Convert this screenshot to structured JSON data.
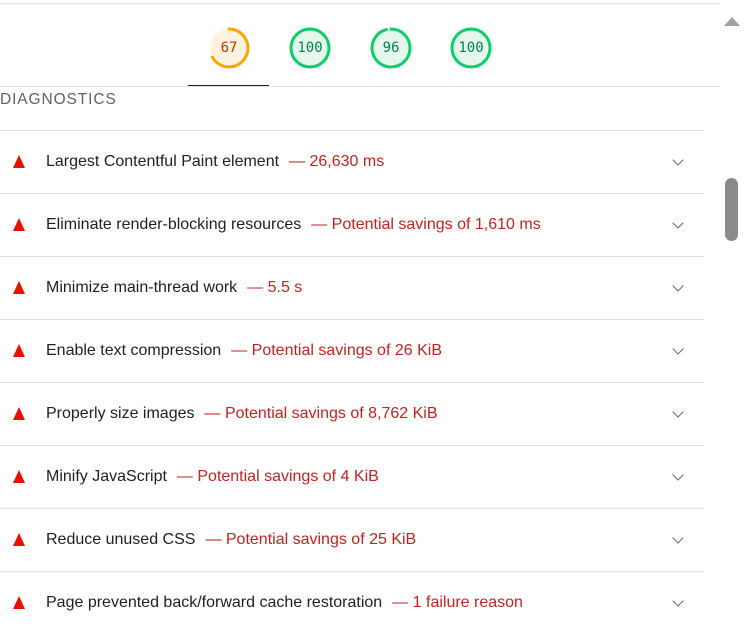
{
  "gauges": [
    {
      "value": "67",
      "score": 0.67,
      "color": "#ffa400",
      "fill": "#fff3e0",
      "text_color": "#c33300",
      "selected": true
    },
    {
      "value": "100",
      "score": 1.0,
      "color": "#0cce6b",
      "fill": "#e6f8ee",
      "text_color": "#018642",
      "selected": false
    },
    {
      "value": "96",
      "score": 0.96,
      "color": "#0cce6b",
      "fill": "#e6f8ee",
      "text_color": "#018642",
      "selected": false
    },
    {
      "value": "100",
      "score": 1.0,
      "color": "#0cce6b",
      "fill": "#e6f8ee",
      "text_color": "#018642",
      "selected": false
    }
  ],
  "section_title": "DIAGNOSTICS",
  "audits": [
    {
      "title": "Largest Contentful Paint element",
      "detail": "— 26,630 ms"
    },
    {
      "title": "Eliminate render-blocking resources",
      "detail": "— Potential savings of 1,610 ms"
    },
    {
      "title": "Minimize main-thread work",
      "detail": "— 5.5 s"
    },
    {
      "title": "Enable text compression",
      "detail": "— Potential savings of 26 KiB"
    },
    {
      "title": "Properly size images",
      "detail": "— Potential savings of 8,762 KiB"
    },
    {
      "title": "Minify JavaScript",
      "detail": "— Potential savings of 4 KiB"
    },
    {
      "title": "Reduce unused CSS",
      "detail": "— Potential savings of 25 KiB"
    },
    {
      "title": "Page prevented back/forward cache restoration",
      "detail": "— 1 failure reason"
    }
  ],
  "icons": {
    "audit_status": "warning-triangle-icon",
    "audit_expand": "chevron-down-icon",
    "scroll_up": "scroll-up-arrow-icon"
  },
  "colors": {
    "fail": "#eb0f00",
    "fail_text": "#c5221f",
    "average": "#ffa400",
    "pass": "#0cce6b"
  }
}
